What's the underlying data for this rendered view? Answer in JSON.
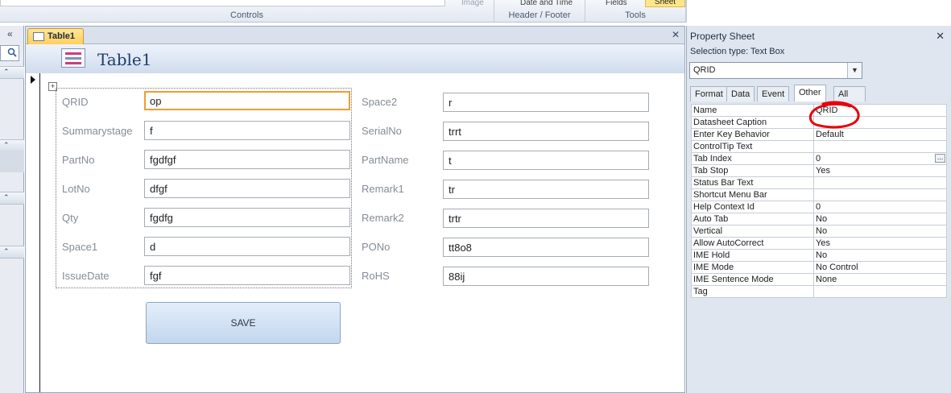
{
  "ribbon": {
    "controls_label": "Controls",
    "image_label": "Image",
    "header_footer_label": "Header / Footer",
    "date_time_label": "Date and Time",
    "tools_label": "Tools",
    "fields_label": "Fields",
    "sheet_label": "Sheet"
  },
  "nav": {
    "chevron": "«",
    "group_chevron": "⌃"
  },
  "document": {
    "tab_label": "Table1",
    "form_title": "Table1",
    "close": "✕",
    "fields_left": [
      {
        "label": "QRID",
        "value": "op"
      },
      {
        "label": "Summarystage",
        "value": "f"
      },
      {
        "label": "PartNo",
        "value": "fgdfgf"
      },
      {
        "label": "LotNo",
        "value": "dfgf"
      },
      {
        "label": "Qty",
        "value": "fgdfg"
      },
      {
        "label": "Space1",
        "value": "d"
      },
      {
        "label": "IssueDate",
        "value": "fgf"
      }
    ],
    "fields_right": [
      {
        "label": "Space2",
        "value": "r"
      },
      {
        "label": "SerialNo",
        "value": "trrt"
      },
      {
        "label": "PartName",
        "value": "t"
      },
      {
        "label": "Remark1",
        "value": "tr"
      },
      {
        "label": "Remark2",
        "value": "trtr"
      },
      {
        "label": "PONo",
        "value": "tt8o8"
      },
      {
        "label": "RoHS",
        "value": "88ij"
      }
    ],
    "save_label": "SAVE"
  },
  "property_sheet": {
    "title": "Property Sheet",
    "close": "✕",
    "selection_type": "Selection type:  Text Box",
    "selected_control": "QRID",
    "tabs": [
      "Format",
      "Data",
      "Event",
      "Other",
      "All"
    ],
    "active_tab": "Other",
    "rows": [
      {
        "name": "Name",
        "value": "QRID"
      },
      {
        "name": "Datasheet Caption",
        "value": ""
      },
      {
        "name": "Enter Key Behavior",
        "value": "Default"
      },
      {
        "name": "ControlTip Text",
        "value": ""
      },
      {
        "name": "Tab Index",
        "value": "0"
      },
      {
        "name": "Tab Stop",
        "value": "Yes"
      },
      {
        "name": "Status Bar Text",
        "value": ""
      },
      {
        "name": "Shortcut Menu Bar",
        "value": ""
      },
      {
        "name": "Help Context Id",
        "value": "0"
      },
      {
        "name": "Auto Tab",
        "value": "No"
      },
      {
        "name": "Vertical",
        "value": "No"
      },
      {
        "name": "Allow AutoCorrect",
        "value": "Yes"
      },
      {
        "name": "IME Hold",
        "value": "No"
      },
      {
        "name": "IME Mode",
        "value": "No Control"
      },
      {
        "name": "IME Sentence Mode",
        "value": "None"
      },
      {
        "name": "Tag",
        "value": ""
      }
    ],
    "annotation_color": "#e8000b"
  },
  "colors": {
    "accent_tab": "#ffcf5a",
    "focus_border": "#f39c2c",
    "header_title": "#1f3d6e"
  }
}
